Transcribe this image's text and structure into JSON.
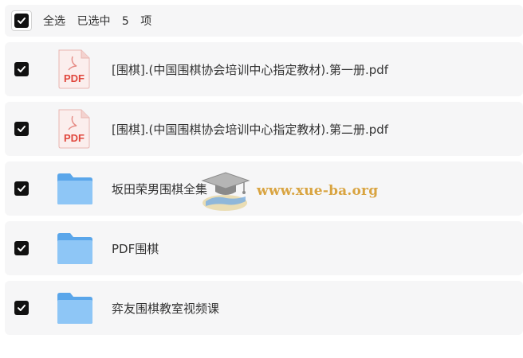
{
  "header": {
    "select_all_label": "全选",
    "selected_label": "已选中",
    "count": "5",
    "unit": "项"
  },
  "items": [
    {
      "type": "pdf",
      "icon": "pdf-file-icon",
      "badge": "PDF",
      "name": "[围棋].(中国围棋协会培训中心指定教材).第一册.pdf",
      "checked": true
    },
    {
      "type": "pdf",
      "icon": "pdf-file-icon",
      "badge": "PDF",
      "name": "[围棋].(中国围棋协会培训中心指定教材).第二册.pdf",
      "checked": true
    },
    {
      "type": "folder",
      "icon": "folder-icon",
      "name": "坂田荣男围棋全集",
      "checked": true
    },
    {
      "type": "folder",
      "icon": "folder-icon",
      "name": "PDF围棋",
      "checked": true
    },
    {
      "type": "folder",
      "icon": "folder-icon",
      "name": "弈友围棋教室视频课",
      "checked": true
    }
  ],
  "watermark": {
    "text": "www.xue-ba.org",
    "icon": "graduation-cap-icon"
  },
  "colors": {
    "row_bg": "#f6f6f7",
    "check": "#111111",
    "pdf_red": "#e0463c",
    "folder_blue": "#6fb4f0",
    "watermark": "#d9a441"
  }
}
